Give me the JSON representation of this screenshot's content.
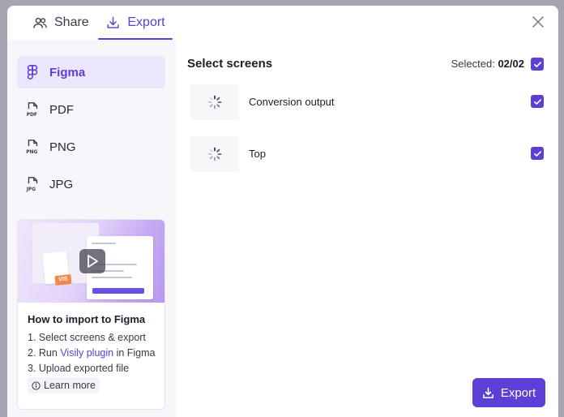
{
  "header": {
    "tabs": [
      {
        "label": "Share",
        "icon": "users-icon"
      },
      {
        "label": "Export",
        "icon": "download-icon",
        "active": true
      }
    ]
  },
  "sidebar": {
    "formats": [
      {
        "label": "Figma",
        "icon": "figma-icon",
        "active": true
      },
      {
        "label": "PDF",
        "icon": "pdf-file-icon"
      },
      {
        "label": "PNG",
        "icon": "png-file-icon"
      },
      {
        "label": "JPG",
        "icon": "jpg-file-icon"
      }
    ],
    "tutorial": {
      "title": "How to import to Figma",
      "step1": "1.  Select screens & export",
      "step2_prefix": "2. Run ",
      "step2_link": "Visily plugin",
      "step2_suffix": " in Figma",
      "step3": "3. Upload exported file",
      "learn_more": "Learn more",
      "thumb_tag": "VIS"
    }
  },
  "main": {
    "title": "Select screens",
    "selected_label": "Selected:",
    "selected_count": "02/02",
    "screens": [
      {
        "name": "Conversion output",
        "checked": true
      },
      {
        "name": "Top",
        "checked": true
      }
    ],
    "export_button": "Export"
  },
  "colors": {
    "accent": "#5b3fd6",
    "active_bg": "#ebe6fb",
    "sidebar_bg": "#f7f6fa"
  }
}
